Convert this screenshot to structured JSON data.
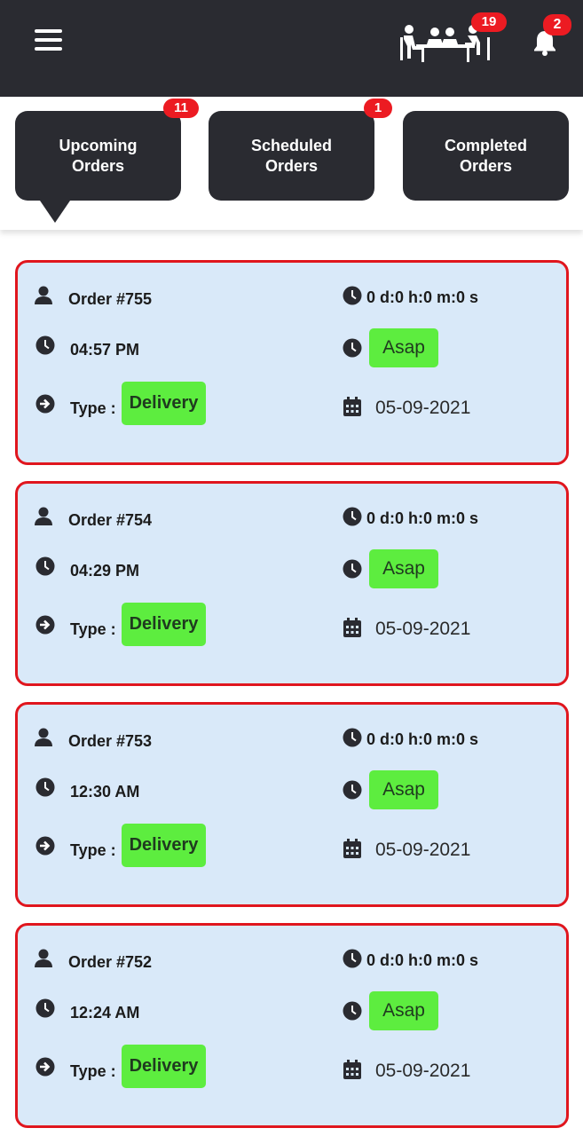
{
  "header": {
    "menu_icon": "hamburger-menu-icon",
    "tables_icon": "dining-table-people-icon",
    "tables_badge": "19",
    "notifications_icon": "bell-icon",
    "notifications_badge": "2"
  },
  "tabs": [
    {
      "label_line1": "Upcoming",
      "label_line2": "Orders",
      "badge": "11",
      "active": true
    },
    {
      "label_line1": "Scheduled",
      "label_line2": "Orders",
      "badge": "1",
      "active": false
    },
    {
      "label_line1": "Completed",
      "label_line2": "Orders",
      "badge": null,
      "active": false
    }
  ],
  "orders": [
    {
      "order_no": "Order #755",
      "countdown": "0 d:0 h:0 m:0 s",
      "time": "04:57 PM",
      "timing": "Asap",
      "type_label": "Type :",
      "type": "Delivery",
      "date": "05-09-2021"
    },
    {
      "order_no": "Order #754",
      "countdown": "0 d:0 h:0 m:0 s",
      "time": "04:29 PM",
      "timing": "Asap",
      "type_label": "Type :",
      "type": "Delivery",
      "date": "05-09-2021"
    },
    {
      "order_no": "Order #753",
      "countdown": "0 d:0 h:0 m:0 s",
      "time": "12:30 AM",
      "timing": "Asap",
      "type_label": "Type :",
      "type": "Delivery",
      "date": "05-09-2021"
    },
    {
      "order_no": "Order #752",
      "countdown": "0 d:0 h:0 m:0 s",
      "time": "12:24 AM",
      "timing": "Asap",
      "type_label": "Type :",
      "type": "Delivery",
      "date": "05-09-2021"
    }
  ],
  "colors": {
    "header_bg": "#2a2b31",
    "card_bg": "#d9e9f9",
    "card_border": "#e0161e",
    "badge": "#ec1b22",
    "pill_green": "#5ded3f"
  }
}
